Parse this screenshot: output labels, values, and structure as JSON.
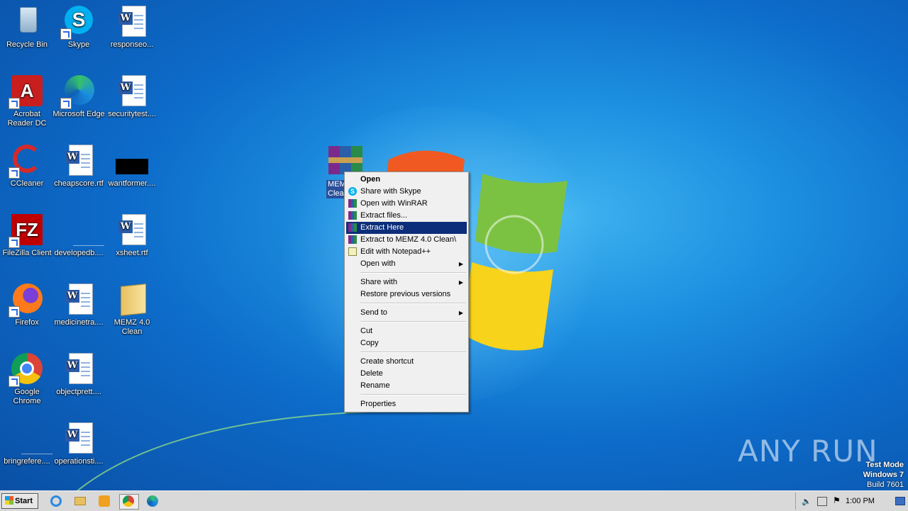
{
  "desktop_icons": [
    {
      "label": "Recycle Bin",
      "icon": "recycle-bin-icon"
    },
    {
      "label": "Skype",
      "icon": "skype-icon"
    },
    {
      "label": "responseo...",
      "icon": "word-document-icon"
    },
    {
      "label": "Acrobat Reader DC",
      "icon": "acrobat-icon"
    },
    {
      "label": "Microsoft Edge",
      "icon": "edge-icon"
    },
    {
      "label": "securitytest....",
      "icon": "word-document-icon"
    },
    {
      "label": "CCleaner",
      "icon": "ccleaner-icon"
    },
    {
      "label": "cheapscore.rtf",
      "icon": "word-document-icon"
    },
    {
      "label": "wantformer....",
      "icon": "black-file-icon"
    },
    {
      "label": "FileZilla Client",
      "icon": "filezilla-icon"
    },
    {
      "label": "developedb....",
      "icon": "blank-file-icon"
    },
    {
      "label": "xsheet.rtf",
      "icon": "word-document-icon"
    },
    {
      "label": "Firefox",
      "icon": "firefox-icon"
    },
    {
      "label": "medicinetra....",
      "icon": "word-document-icon"
    },
    {
      "label": "MEMZ 4.0 Clean",
      "icon": "folder-icon"
    },
    {
      "label": "Google Chrome",
      "icon": "chrome-icon"
    },
    {
      "label": "objectprett....",
      "icon": "word-document-icon"
    },
    {
      "label": "bringrefere....",
      "icon": "blank-file-icon"
    },
    {
      "label": "operationsti....",
      "icon": "word-document-icon"
    }
  ],
  "selected_file": {
    "label_line1": "MEM",
    "label_line2": "Clea",
    "icon": "winrar-archive-icon"
  },
  "context_menu": {
    "items": [
      {
        "label": "Open",
        "bold": true
      },
      {
        "label": "Share with Skype",
        "icon": "skype-icon"
      },
      {
        "label": "Open with WinRAR",
        "icon": "winrar-icon"
      },
      {
        "label": "Extract files...",
        "icon": "winrar-icon"
      },
      {
        "label": "Extract Here",
        "icon": "winrar-icon",
        "highlighted": true
      },
      {
        "label": "Extract to MEMZ 4.0 Clean\\",
        "icon": "winrar-icon"
      },
      {
        "label": "Edit with Notepad++",
        "icon": "notepadpp-icon"
      },
      {
        "label": "Open with",
        "submenu": true
      },
      {
        "label": "Share with",
        "submenu": true
      },
      {
        "label": "Restore previous versions"
      },
      {
        "label": "Send to",
        "submenu": true
      },
      {
        "label": "Cut"
      },
      {
        "label": "Copy"
      },
      {
        "label": "Create shortcut"
      },
      {
        "label": "Delete"
      },
      {
        "label": "Rename"
      },
      {
        "label": "Properties"
      }
    ]
  },
  "taskbar": {
    "start_label": "Start",
    "pinned": [
      "internet-explorer-icon",
      "explorer-folder-icon",
      "media-player-icon",
      "chrome-icon",
      "edge-icon"
    ],
    "clock": "1:00 PM"
  },
  "watermark": {
    "line1": "Test Mode",
    "line2": "Windows 7",
    "line3": "Build 7601"
  },
  "anyrun_logo": "ANY RUN"
}
